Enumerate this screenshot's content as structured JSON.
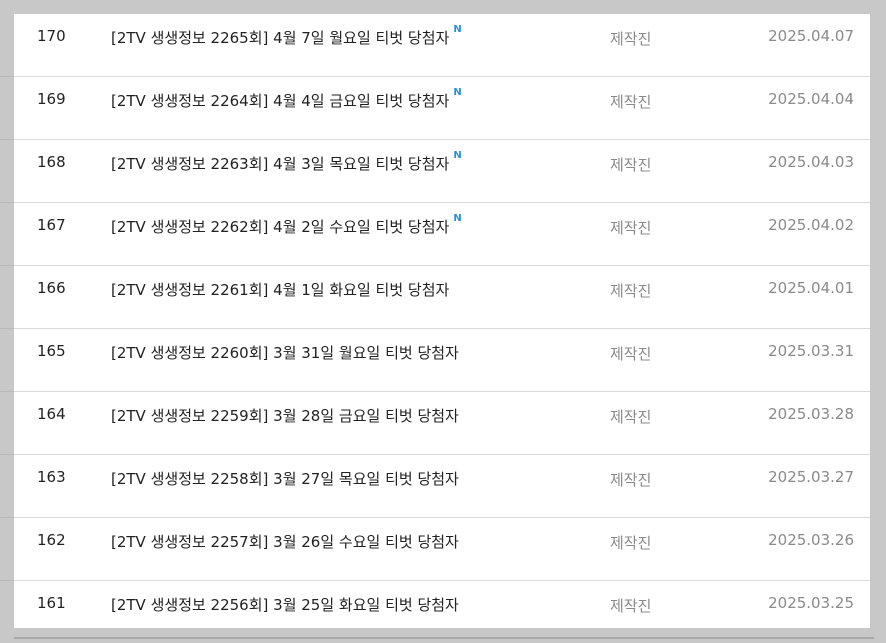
{
  "posts": [
    {
      "num": "170",
      "title": "[2TV 생생정보 2265회] 4월 7일 월요일 티벗 당첨자",
      "is_new": true,
      "author": "제작진",
      "date": "2025.04.07"
    },
    {
      "num": "169",
      "title": "[2TV 생생정보 2264회] 4월 4일 금요일 티벗 당첨자",
      "is_new": true,
      "author": "제작진",
      "date": "2025.04.04"
    },
    {
      "num": "168",
      "title": "[2TV 생생정보 2263회] 4월 3일 목요일 티벗 당첨자",
      "is_new": true,
      "author": "제작진",
      "date": "2025.04.03"
    },
    {
      "num": "167",
      "title": "[2TV 생생정보 2262회] 4월 2일 수요일 티벗 당첨자",
      "is_new": true,
      "author": "제작진",
      "date": "2025.04.02"
    },
    {
      "num": "166",
      "title": "[2TV 생생정보 2261회] 4월 1일 화요일 티벗 당첨자",
      "is_new": false,
      "author": "제작진",
      "date": "2025.04.01"
    },
    {
      "num": "165",
      "title": "[2TV 생생정보 2260회] 3월 31일 월요일 티벗 당첨자",
      "is_new": false,
      "author": "제작진",
      "date": "2025.03.31"
    },
    {
      "num": "164",
      "title": "[2TV 생생정보 2259회] 3월 28일 금요일 티벗 당첨자",
      "is_new": false,
      "author": "제작진",
      "date": "2025.03.28"
    },
    {
      "num": "163",
      "title": "[2TV 생생정보 2258회] 3월 27일 목요일 티벗 당첨자",
      "is_new": false,
      "author": "제작진",
      "date": "2025.03.27"
    },
    {
      "num": "162",
      "title": "[2TV 생생정보 2257회] 3월 26일 수요일 티벗 당첨자",
      "is_new": false,
      "author": "제작진",
      "date": "2025.03.26"
    },
    {
      "num": "161",
      "title": "[2TV 생생정보 2256회] 3월 25일 화요일 티벗 당첨자",
      "is_new": false,
      "author": "제작진",
      "date": "2025.03.25"
    }
  ],
  "new_badge_label": "N",
  "colors": {
    "new_badge": "#2a8fd8",
    "meta_text": "#8a8a8a",
    "title_text": "#222222",
    "background": "#c8c8c8"
  }
}
